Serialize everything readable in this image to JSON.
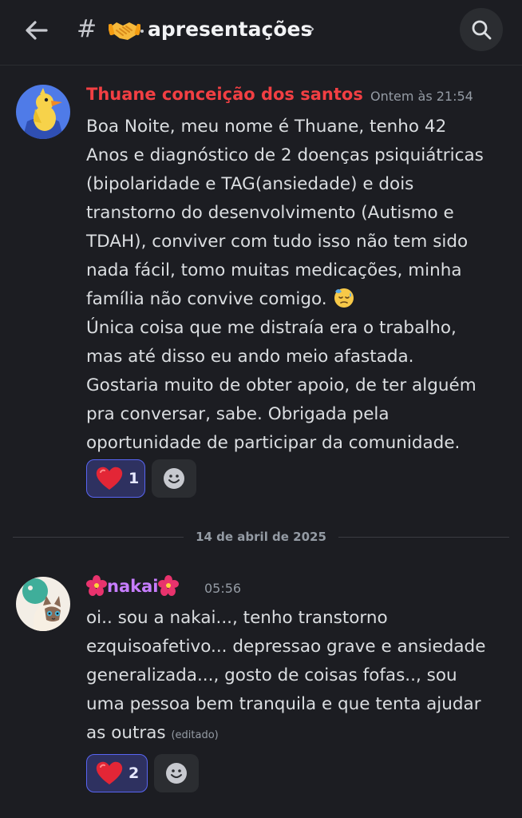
{
  "header": {
    "back_icon": "arrow-left-icon",
    "hash": "#",
    "channel_emoji": "handshake-emoji",
    "channel_name": "apresentações",
    "chevron": "›",
    "search_icon": "search-icon"
  },
  "messages": [
    {
      "author": "Thuane conceição dos santos",
      "author_color": "#f23f43",
      "timestamp": "Ontem às 21:54",
      "text": "Boa Noite, meu nome é Thuane, tenho 42\nAnos e diagnóstico de 2 doenças psiquiátricas\n(bipolaridade e TAG(ansiedade) e dois\ntranstorno do desenvolvimento (Autismo e\nTDAH), conviver com tudo isso não tem sido\nnada fácil, tomo muitas medicações, minha\nfamília não convive comigo.",
      "text_emoji": "downcast-sweat-face-emoji",
      "text2": "Única coisa que me distraía era o trabalho,\nmas até disso eu ando meio afastada.\nGostaria muito de obter apoio, de ter alguém\npra conversar, sabe. Obrigada pela\noportunidade de participar da comunidade.",
      "reaction": {
        "emoji": "red-heart-emoji",
        "count": "1"
      }
    },
    {
      "author": "nakai",
      "author_color": "#c77dff",
      "author_decoration": "hibiscus-emoji",
      "timestamp": "05:56",
      "text": "oi.. sou a nakai..., tenho transtorno\nezquisoafetivo... depressao grave e ansiedade\ngeneralizada..., gosto de coisas fofas.., sou\numa pessoa bem tranquila e que tenta ajudar\nas outras",
      "edited": "(editado)",
      "reaction": {
        "emoji": "red-heart-emoji",
        "count": "2"
      }
    }
  ],
  "date_divider": "14 de abril de 2025",
  "colors": {
    "background": "#1c1d22",
    "accent": "#5865f2",
    "reaction_bg": "#2e3160"
  }
}
